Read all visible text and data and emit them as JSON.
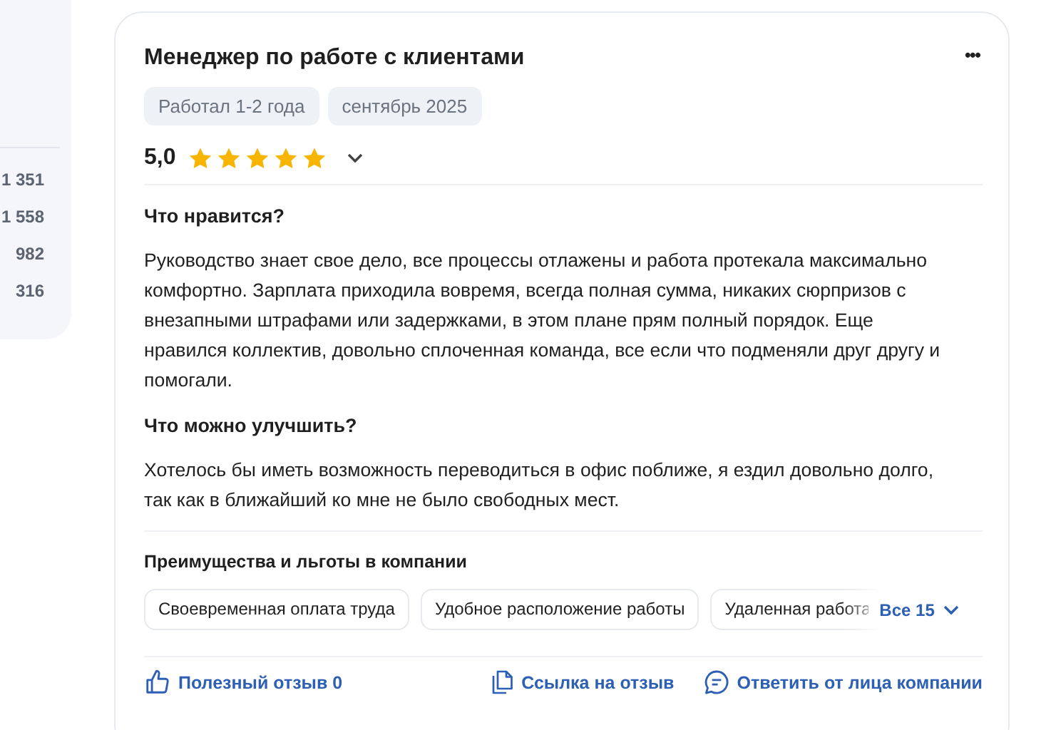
{
  "sidebar": {
    "counts": [
      "1 351",
      "1 558",
      "982",
      "316"
    ]
  },
  "review": {
    "title": "Менеджер по работе с клиентами",
    "menu_icon": "•••",
    "tags": [
      "Работал 1-2 года",
      "сентябрь 2025"
    ],
    "rating": {
      "value": "5,0",
      "stars": 5,
      "expanded": false
    },
    "sections": [
      {
        "heading": "Что нравится?",
        "text": "Руководство знает свое дело, все процессы отлажены и работа протекала максимально комфортно. Зарплата приходила вовремя, всегда полная сумма, никаких сюрпризов с внезапными штрафами или задержками, в этом плане прям полный порядок. Еще нравился коллектив, довольно сплоченная команда, все если что подменяли друг другу и помогали."
      },
      {
        "heading": "Что можно улучшить?",
        "text": "Хотелось бы иметь возможность переводиться в офис поближе, я ездил довольно долго, так как в ближайший ко мне не было свободных мест."
      }
    ],
    "benefits": {
      "heading": "Преимущества и льготы в компании",
      "items": [
        "Своевременная оплата труда",
        "Удобное расположение работы",
        "Удаленная работа"
      ],
      "more": "Все 15"
    },
    "actions": [
      {
        "kind": "like",
        "label": "Полезный отзыв 0"
      },
      {
        "kind": "link",
        "label": "Ссылка на отзыв"
      },
      {
        "kind": "reply",
        "label": "Ответить от лица компании"
      }
    ]
  }
}
